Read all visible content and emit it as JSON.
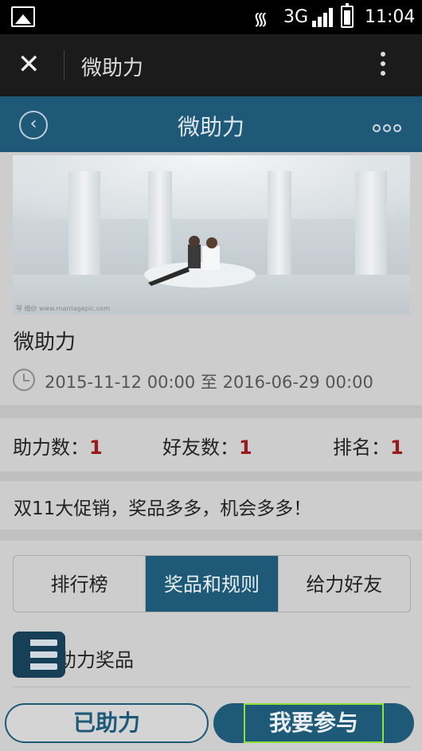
{
  "status_bar": {
    "network": "3G",
    "time": "11:04"
  },
  "app_bar": {
    "close_glyph": "✕",
    "title": "微助力"
  },
  "page_header": {
    "back_glyph": "‹",
    "title": "微助力"
  },
  "event": {
    "title": "微助力",
    "date_range": "2015-11-12 00:00 至 2016-06-29 00:00",
    "banner_watermark": "琴 婚纱 www.marriagepic.com"
  },
  "stats": {
    "support_label": "助力数：",
    "support_value": "1",
    "friends_label": "好友数：",
    "friends_value": "1",
    "rank_label": "排名：",
    "rank_value": "1"
  },
  "promo_text": "双11大促销，奖品多多，机会多多！",
  "tabs": [
    {
      "label": "排行榜",
      "active": false
    },
    {
      "label": "奖品和规则",
      "active": true
    },
    {
      "label": "给力好友",
      "active": false
    }
  ],
  "section": {
    "title": "助力奖品"
  },
  "actions": {
    "helped_label": "已助力",
    "join_label": "我要参与"
  },
  "colors": {
    "accent": "#1e5a78",
    "stat_number": "#9a1a1a",
    "highlight": "#8fe03a"
  }
}
